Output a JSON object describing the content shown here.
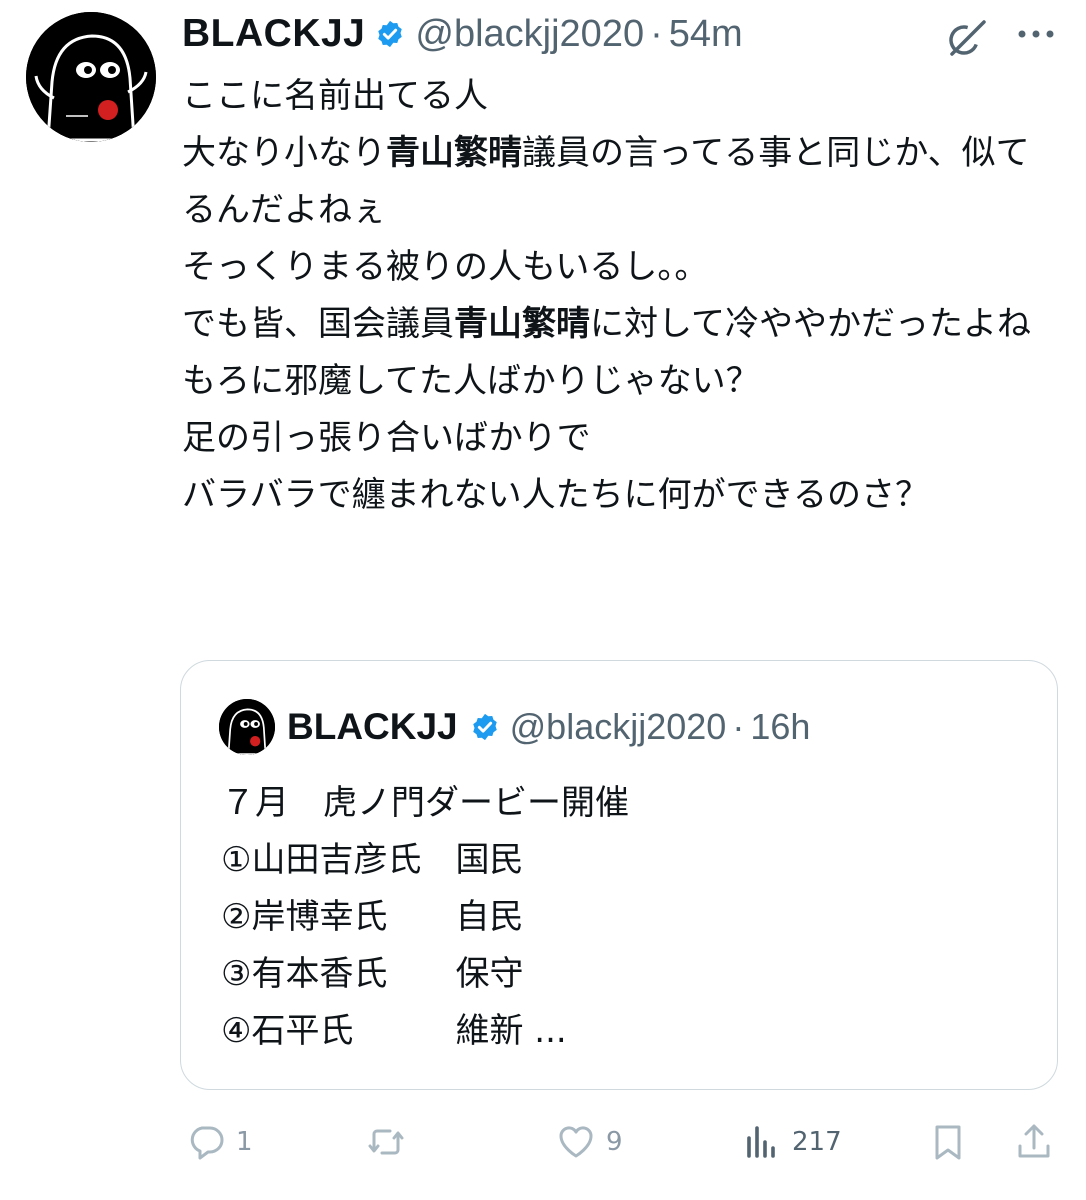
{
  "tweet": {
    "author": {
      "display_name": "BLACKJJ",
      "handle": "@blackjj2020",
      "verified": true,
      "avatar_icon": "black-ghost-avatar-icon"
    },
    "separator": "·",
    "time": "54m",
    "text_parts": [
      "ここに名前出てる人\n大なり小なり",
      "青山繁晴",
      "議員の言ってる事と同じか、似てるんだよねぇ\nそっくりまる被りの人もいるし。。\nでも皆、国会議員",
      "青山繁晴",
      "に対して冷ややかだったよね\nもろに邪魔してた人ばかりじゃない？\n足の引っ張り合いばかりで\nバラバラで纏まれない人たちに何ができるのさ？"
    ],
    "top_icons": [
      "grok-icon",
      "more-options-icon"
    ]
  },
  "quoted": {
    "display_name": "BLACKJJ",
    "handle": "@blackjj2020",
    "separator": "·",
    "time": "16h",
    "lines": [
      "７月　虎ノ門ダービー開催",
      "①山田吉彦氏　国民",
      "②岸博幸氏　　自民",
      "③有本香氏　　保守",
      "④石平氏　　　維新 ..."
    ]
  },
  "actions": {
    "reply_count": "1",
    "repost_count": "",
    "like_count": "9",
    "views_count": "217"
  },
  "colors": {
    "text": "#0f1419",
    "secondary": "#536471",
    "verified": "#1d9bf0",
    "border": "#cfd9de",
    "action_icon": "#aab8c2"
  }
}
